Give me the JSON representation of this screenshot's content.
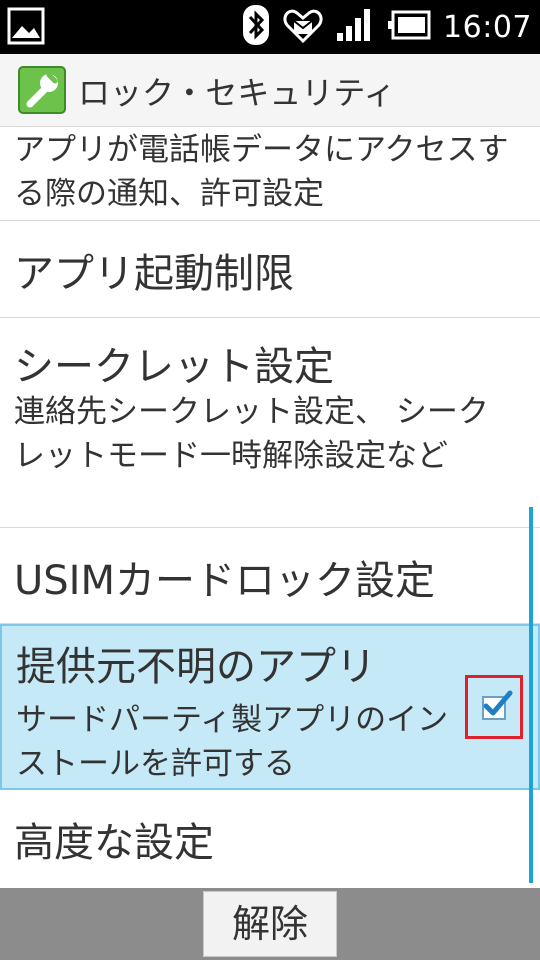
{
  "status_bar": {
    "time": "16:07",
    "icons": [
      "image-icon",
      "bluetooth-icon",
      "heart-mail-icon",
      "signal-icon",
      "battery-icon"
    ]
  },
  "app_bar": {
    "title": "ロック・セキュリティ",
    "icon": "wrench-icon"
  },
  "items": [
    {
      "summary": "アプリが電話帳データにアクセスする際の通知、許可設定"
    },
    {
      "title": "アプリ起動制限"
    },
    {
      "title": "シークレット設定",
      "summary": "連絡先シークレット設定、 シークレットモード一時解除設定など"
    },
    {
      "title": "USIMカードロック設定"
    },
    {
      "title": "提供元不明のアプリ",
      "summary": "サードパーティ製アプリのインストールを許可する",
      "checked": true
    },
    {
      "title": "高度な設定"
    }
  ],
  "bottom_bar": {
    "button_label": "解除"
  },
  "colors": {
    "accent": "#1ea3d8",
    "selected_bg": "#c6e9f7",
    "highlight_border": "#e0202a"
  }
}
